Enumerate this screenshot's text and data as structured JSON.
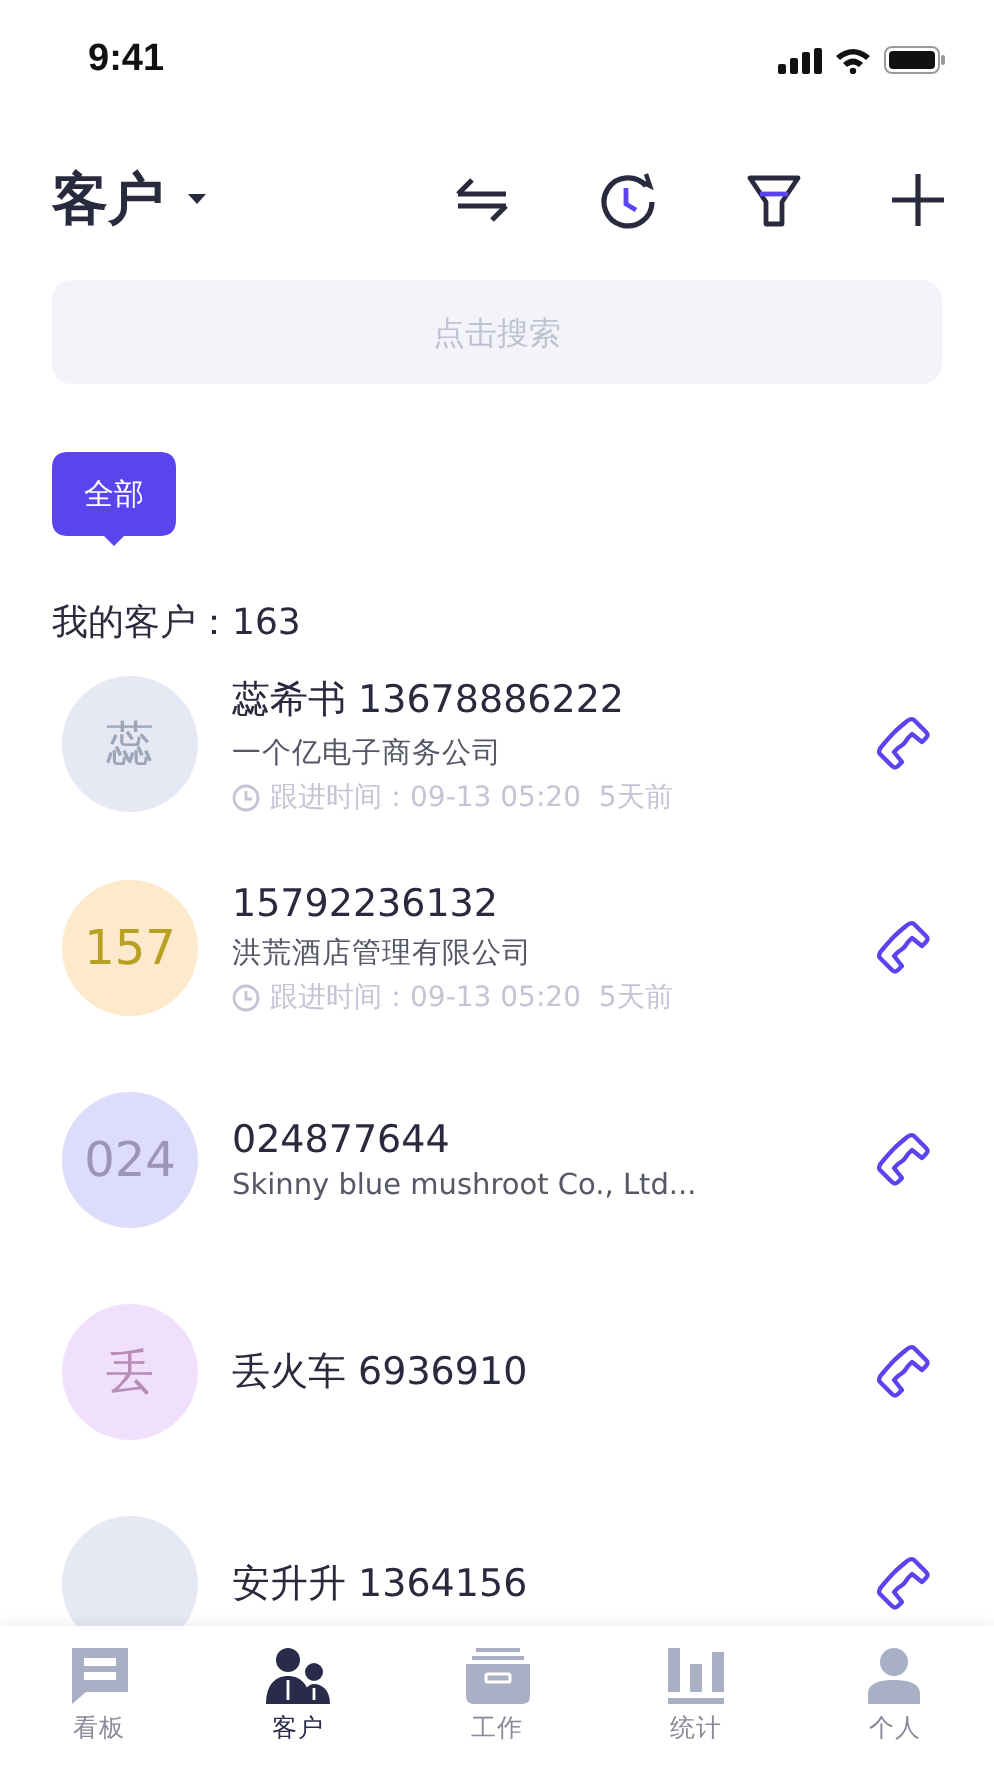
{
  "status_bar": {
    "time": "9:41"
  },
  "header": {
    "title": "客户"
  },
  "search": {
    "placeholder": "点击搜索"
  },
  "filter_tag": {
    "label": "全部",
    "selected": true
  },
  "count_label": "我的客户：163",
  "customers": [
    {
      "avatar": "蕊",
      "color": "#e6e8f4",
      "name": "蕊希书 13678886222",
      "company": "一个亿电子商务公司",
      "follow_time": "跟进时间：09-13 05:20  5天前"
    },
    {
      "avatar": "157",
      "color": "#fde9cc",
      "name": "15792236132",
      "company": "洪荒酒店管理有限公司",
      "follow_time": "跟进时间：09-13 05:20  5天前"
    },
    {
      "avatar": "024",
      "color": "#dedcfb",
      "name": "024877644",
      "company": "Skinny blue mushroot Co., Ltd..."
    },
    {
      "avatar": "丢",
      "color": "#f1e0fb",
      "name": "丢火车 6936910"
    },
    {
      "color": "#e6e8f4",
      "name": "安升升 1364156"
    }
  ],
  "tab_bar": [
    {
      "label": "看板",
      "kind": "board",
      "selected": false
    },
    {
      "label": "客户",
      "kind": "customers",
      "selected": true
    },
    {
      "label": "工作",
      "kind": "work",
      "selected": false
    },
    {
      "label": "统计",
      "kind": "stats",
      "selected": false
    },
    {
      "label": "个人",
      "kind": "profile",
      "selected": false
    }
  ]
}
